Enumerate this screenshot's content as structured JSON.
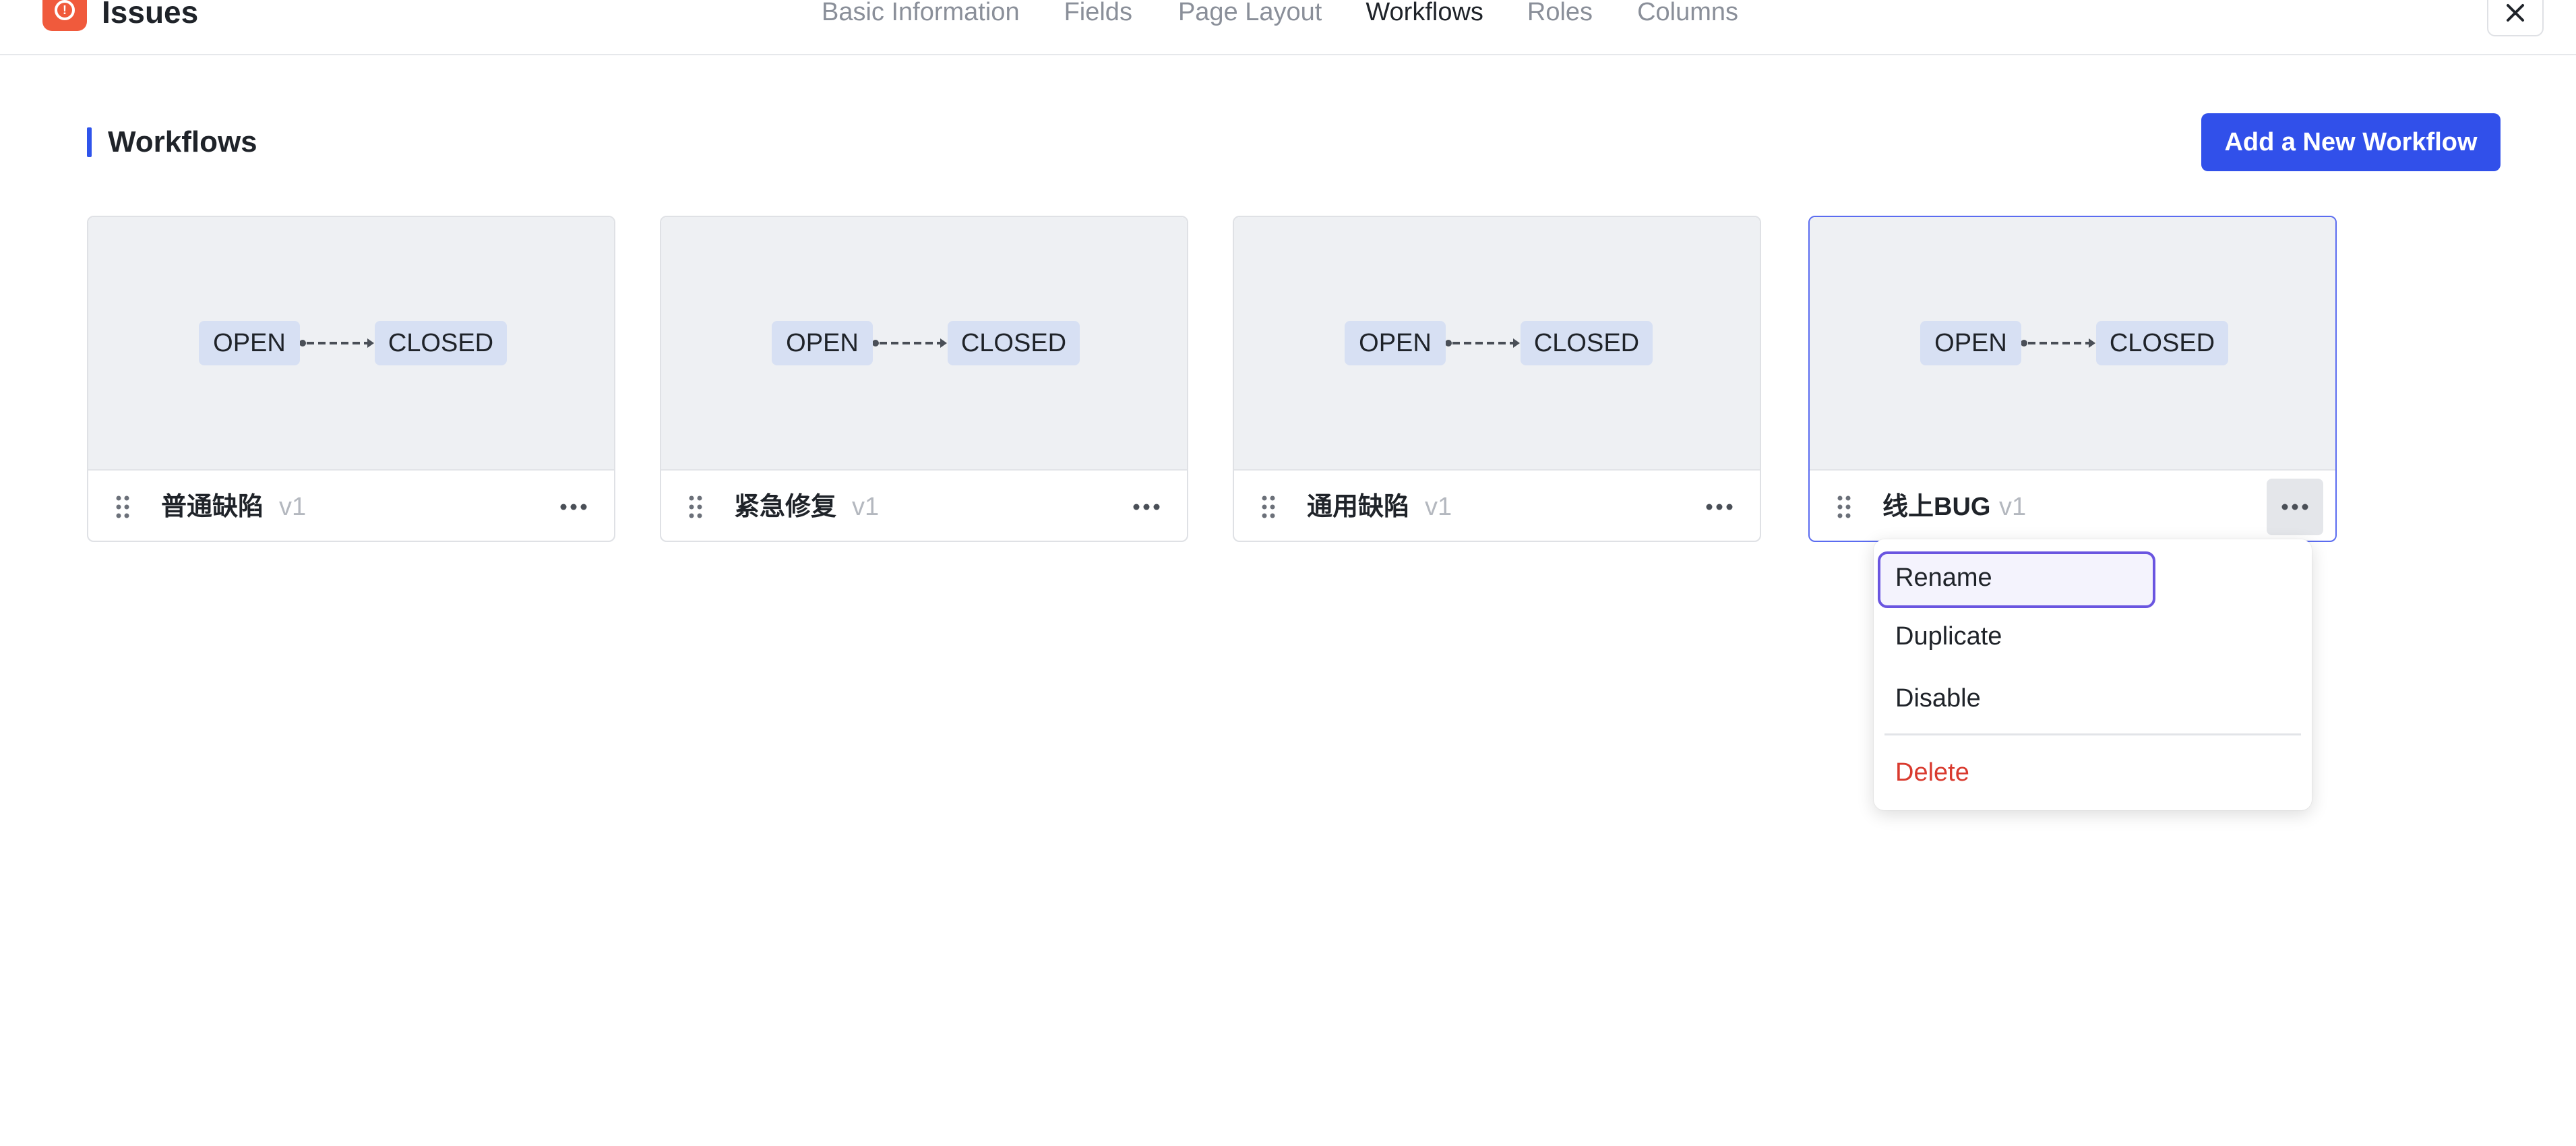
{
  "app": {
    "title": "Issues",
    "logo_icon": "alert-circle-icon",
    "logo_color": "#f05a3c"
  },
  "nav": {
    "tabs": [
      {
        "label": "Basic Information",
        "active": false
      },
      {
        "label": "Fields",
        "active": false
      },
      {
        "label": "Page Layout",
        "active": false
      },
      {
        "label": "Workflows",
        "active": true
      },
      {
        "label": "Roles",
        "active": false
      },
      {
        "label": "Columns",
        "active": false
      }
    ],
    "close_icon": "close-icon"
  },
  "section": {
    "title": "Workflows",
    "add_button_label": "Add a New Workflow",
    "accent_color": "#3150ea"
  },
  "workflows": [
    {
      "name": "普通缺陷",
      "version": "v1",
      "from_state": "OPEN",
      "to_state": "CLOSED",
      "selected": false
    },
    {
      "name": "紧急修复",
      "version": "v1",
      "from_state": "OPEN",
      "to_state": "CLOSED",
      "selected": false
    },
    {
      "name": "通用缺陷",
      "version": "v1",
      "from_state": "OPEN",
      "to_state": "CLOSED",
      "selected": false
    },
    {
      "name": "线上BUG",
      "version": "v1",
      "from_state": "OPEN",
      "to_state": "CLOSED",
      "selected": true
    }
  ],
  "menu": {
    "items": [
      {
        "label": "Rename",
        "focused": true
      },
      {
        "label": "Duplicate"
      },
      {
        "label": "Disable"
      },
      {
        "label": "Delete",
        "danger": true
      }
    ],
    "danger_color": "#d93a2e"
  }
}
